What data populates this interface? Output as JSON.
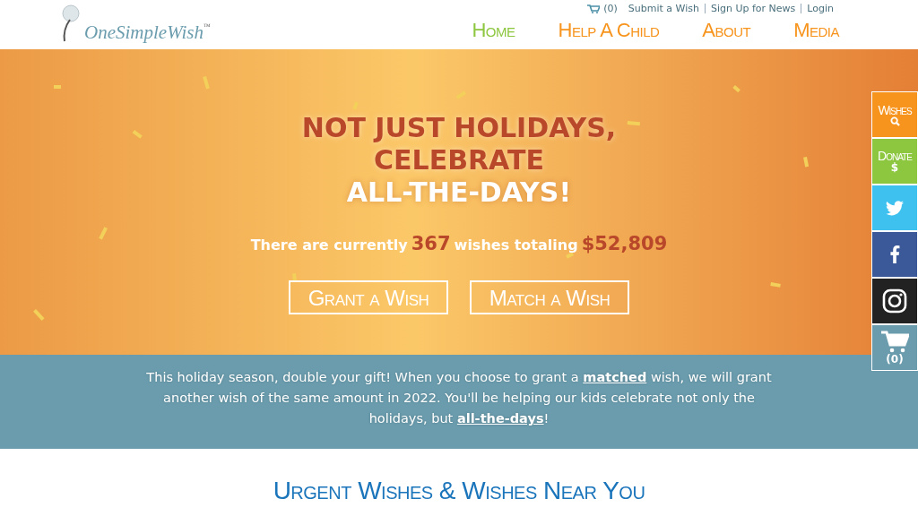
{
  "header": {
    "logo": {
      "name": "OneSimpleWish",
      "mark": "™"
    },
    "cart_count": "(0)",
    "top_links": [
      "Submit a Wish",
      "Sign Up for News",
      "Login"
    ],
    "nav": [
      {
        "label": "Home",
        "selected": true
      },
      {
        "label": "Help A Child",
        "selected": false
      },
      {
        "label": "About",
        "selected": false
      },
      {
        "label": "Media",
        "selected": false
      }
    ]
  },
  "hero": {
    "headline": [
      {
        "text": "NOT JUST HOLIDAYS,",
        "kind": "accent"
      },
      {
        "text": "CELEBRATE",
        "kind": "accent"
      },
      {
        "text": "ALL-THE-DAYS!",
        "kind": "light"
      }
    ],
    "stats": [
      {
        "text": "There are currently",
        "kind": "light"
      },
      {
        "text": "367",
        "kind": "accent"
      },
      {
        "text": "wishes totaling",
        "kind": "light"
      },
      {
        "text": "$52,809",
        "kind": "accent"
      }
    ],
    "buttons": [
      "Grant a Wish",
      "Match a Wish"
    ]
  },
  "side_bar": [
    {
      "kind": "wishes",
      "label": "Wishes",
      "color": "#f7941d"
    },
    {
      "kind": "donate",
      "label": "Donate",
      "sub": "$",
      "color": "#8dc63f"
    },
    {
      "kind": "twitter",
      "color": "#3fc1ef"
    },
    {
      "kind": "facebook",
      "color": "#3b5998"
    },
    {
      "kind": "instagram",
      "color": "#222222"
    },
    {
      "kind": "cart",
      "sub": "(0)",
      "color": "#6a9cad"
    }
  ],
  "banner": {
    "parts": [
      {
        "text": "This holiday season, double your gift! When you choose to grant a",
        "kind": "text"
      },
      {
        "text": "matched",
        "kind": "link"
      },
      {
        "text": "wish, we will grant another wish of the same amount in 2022. You'll be helping our kids celebrate not only the holidays, but",
        "kind": "text"
      },
      {
        "text": "all-the-days",
        "kind": "link"
      },
      {
        "text": "!",
        "kind": "tight"
      }
    ]
  },
  "section": {
    "title": "Urgent Wishes & Wishes Near You"
  }
}
